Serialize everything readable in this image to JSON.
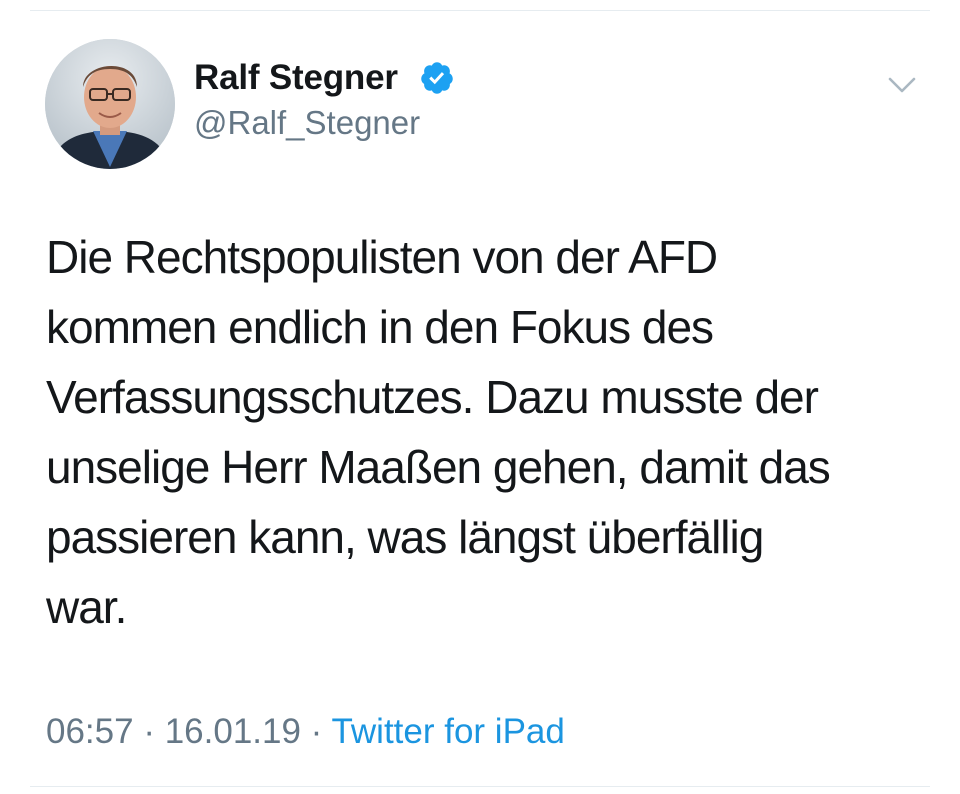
{
  "tweet": {
    "author": {
      "name": "Ralf Stegner",
      "handle": "@Ralf_Stegner",
      "verified_icon": "verified-badge-icon"
    },
    "menu_icon": "chevron-down-icon",
    "text": "Die Rechtspopulisten von der AFD\nkommen endlich in den Fokus des\nVerfassungsschutzes. Dazu musste der\nunselige Herr Maaßen gehen, damit das\npassieren kann, was längst überfällig\nwar.",
    "time": "06:57",
    "separator": " · ",
    "date": "16.01.19",
    "source": "Twitter for iPad"
  },
  "colors": {
    "text": "#14171a",
    "secondary": "#657786",
    "link": "#1b95e0",
    "verified": "#1da1f2",
    "divider": "#e6ecf0"
  }
}
